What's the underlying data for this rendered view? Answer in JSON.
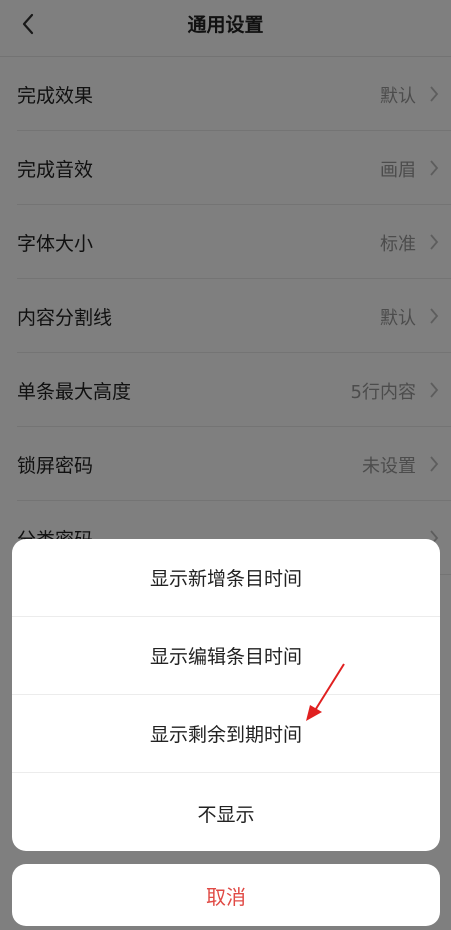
{
  "header": {
    "title": "通用设置",
    "back_icon": "chevron-left-icon"
  },
  "settings": [
    {
      "label": "完成效果",
      "value": "默认"
    },
    {
      "label": "完成音效",
      "value": "画眉"
    },
    {
      "label": "字体大小",
      "value": "标准"
    },
    {
      "label": "内容分割线",
      "value": "默认"
    },
    {
      "label": "单条最大高度",
      "value": "5行内容"
    },
    {
      "label": "锁屏密码",
      "value": "未设置"
    },
    {
      "label": "分类密码",
      "value": ""
    }
  ],
  "action_sheet": {
    "options": [
      "显示新增条目时间",
      "显示编辑条目时间",
      "显示剩余到期时间",
      "不显示"
    ],
    "cancel_label": "取消"
  },
  "colors": {
    "cancel": "#e04a45",
    "annotation_arrow": "#e02020"
  }
}
